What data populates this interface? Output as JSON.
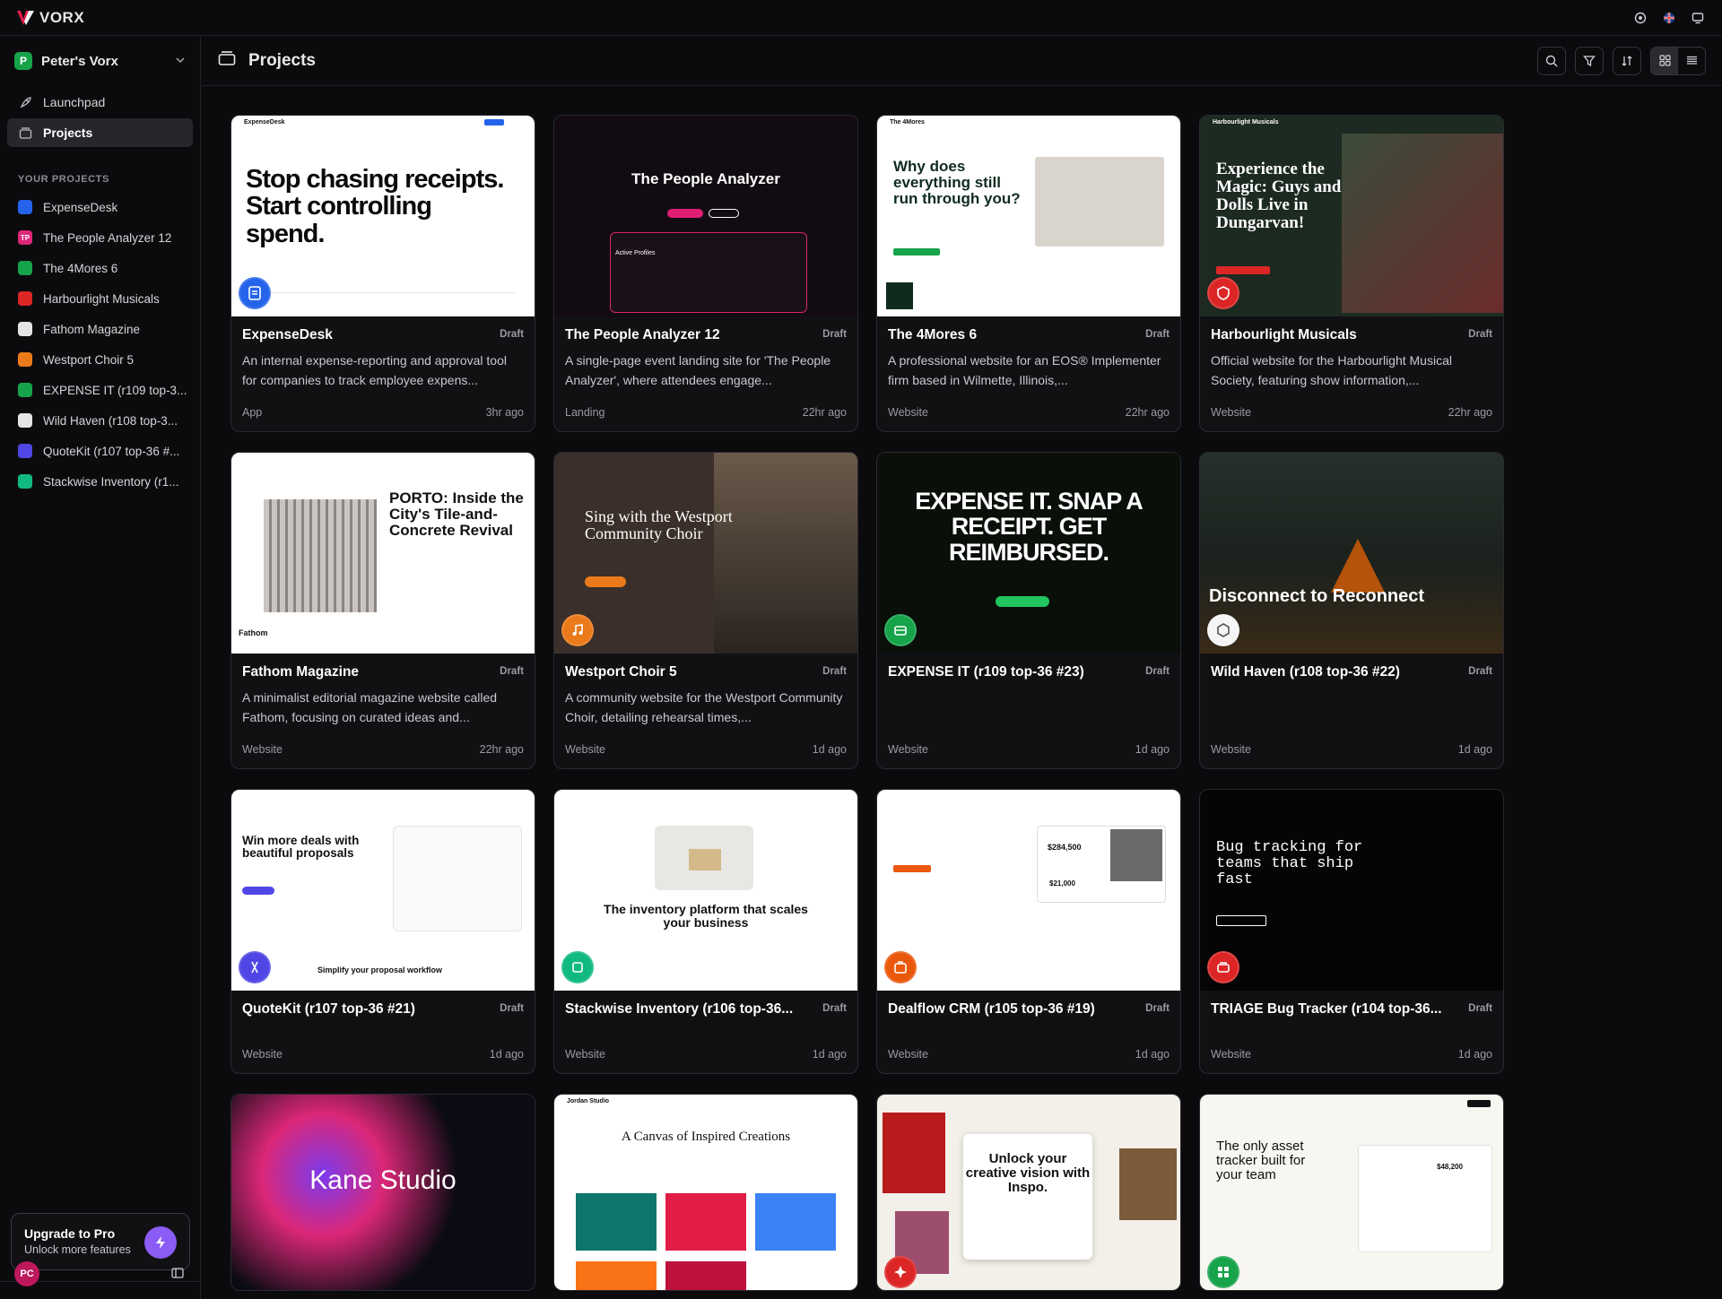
{
  "app": {
    "logo_text": "VORX"
  },
  "sidebar": {
    "workspace": {
      "badge": "P",
      "name": "Peter's Vorx"
    },
    "nav": [
      {
        "label": "Launchpad"
      },
      {
        "label": "Projects"
      }
    ],
    "section_title": "YOUR PROJECTS",
    "projects": [
      {
        "label": "ExpenseDesk",
        "icon": "receipt-icon",
        "color": "#2563eb",
        "glyph": ""
      },
      {
        "label": "The People Analyzer 12",
        "icon": "tp-badge",
        "color": "#db2777",
        "glyph": "TP"
      },
      {
        "label": "The 4Mores 6",
        "icon": "grid-logo-icon",
        "color": "#16a34a",
        "glyph": ""
      },
      {
        "label": "Harbourlight Musicals",
        "icon": "shield-icon",
        "color": "#dc2626",
        "glyph": ""
      },
      {
        "label": "Fathom Magazine",
        "icon": "document-icon",
        "color": "#e5e5e5",
        "glyph": ""
      },
      {
        "label": "Westport Choir 5",
        "icon": "music-icon",
        "color": "#ea7a1a",
        "glyph": ""
      },
      {
        "label": "EXPENSE IT (r109 top-3...",
        "icon": "wallet-icon",
        "color": "#16a34a",
        "glyph": ""
      },
      {
        "label": "Wild Haven (r108 top-3...",
        "icon": "cube-icon",
        "color": "#e5e5e5",
        "glyph": ""
      },
      {
        "label": "QuoteKit (r107 top-36 #...",
        "icon": "quote-icon",
        "color": "#4f46e5",
        "glyph": ""
      },
      {
        "label": "Stackwise Inventory (r1...",
        "icon": "box-icon",
        "color": "#10b981",
        "glyph": ""
      }
    ],
    "upgrade": {
      "title": "Upgrade to Pro",
      "subtitle": "Unlock more features"
    },
    "avatar": "PC"
  },
  "header": {
    "title": "Projects"
  },
  "cards": [
    {
      "name": "ExpenseDesk",
      "status": "Draft",
      "desc": "An internal expense-reporting and approval tool for companies to track employee expens...",
      "type": "App",
      "time": "3hr ago",
      "icon_color": "#2563eb",
      "thumb": {
        "headline": "Stop chasing receipts. Start controlling spend.",
        "brand": "ExpenseDesk"
      }
    },
    {
      "name": "The People Analyzer 12",
      "status": "Draft",
      "desc": "A single-page event landing site for 'The People Analyzer', where attendees engage...",
      "type": "Landing",
      "time": "22hr ago",
      "icon_color": "",
      "thumb": {
        "headline": "The People Analyzer",
        "sub": "Active Profiles"
      }
    },
    {
      "name": "The 4Mores 6",
      "status": "Draft",
      "desc": "A professional website for an EOS® Implementer firm based in Wilmette, Illinois,...",
      "type": "Website",
      "time": "22hr ago",
      "icon_color": "",
      "thumb": {
        "headline": "Why does everything still run through you?",
        "brand": "The 4Mores"
      }
    },
    {
      "name": "Harbourlight Musicals",
      "status": "Draft",
      "desc": "Official website for the Harbourlight Musical Society, featuring show information,...",
      "type": "Website",
      "time": "22hr ago",
      "icon_color": "#dc2626",
      "thumb": {
        "headline": "Experience the Magic: Guys and Dolls Live in Dungarvan!",
        "brand": "Harbourlight Musicals"
      }
    },
    {
      "name": "Fathom Magazine",
      "status": "Draft",
      "desc": "A minimalist editorial magazine website called Fathom, focusing on curated ideas and...",
      "type": "Website",
      "time": "22hr ago",
      "icon_color": "",
      "thumb": {
        "headline": "PORTO: Inside the City's Tile-and-Concrete Revival",
        "brand": "Fathom"
      }
    },
    {
      "name": "Westport Choir 5",
      "status": "Draft",
      "desc": "A community website for the Westport Community Choir, detailing rehearsal times,...",
      "type": "Website",
      "time": "1d ago",
      "icon_color": "#ea7a1a",
      "thumb": {
        "headline": "Sing with the Westport Community Choir"
      }
    },
    {
      "name": "EXPENSE IT (r109 top-36 #23)",
      "status": "Draft",
      "desc": "",
      "type": "Website",
      "time": "1d ago",
      "icon_color": "#16a34a",
      "thumb": {
        "headline": "EXPENSE IT. SNAP A RECEIPT. GET REIMBURSED."
      }
    },
    {
      "name": "Wild Haven (r108 top-36 #22)",
      "status": "Draft",
      "desc": "",
      "type": "Website",
      "time": "1d ago",
      "icon_color": "#f5f5f5",
      "thumb": {
        "headline": "Disconnect to Reconnect"
      }
    },
    {
      "name": "QuoteKit (r107 top-36 #21)",
      "status": "Draft",
      "desc": "",
      "type": "Website",
      "time": "1d ago",
      "icon_color": "#4f46e5",
      "thumb": {
        "headline": "Win more deals with beautiful proposals",
        "sub": "Simplify your proposal workflow"
      }
    },
    {
      "name": "Stackwise Inventory (r106 top-36...",
      "status": "Draft",
      "desc": "",
      "type": "Website",
      "time": "1d ago",
      "icon_color": "#10b981",
      "thumb": {
        "headline": "The inventory platform that scales your business"
      }
    },
    {
      "name": "Dealflow CRM (r105 top-36 #19)",
      "status": "Draft",
      "desc": "",
      "type": "Website",
      "time": "1d ago",
      "icon_color": "#ea580c",
      "thumb": {
        "headline": "$284,500",
        "sub": "$21,000"
      }
    },
    {
      "name": "TRIAGE Bug Tracker (r104 top-36...",
      "status": "Draft",
      "desc": "",
      "type": "Website",
      "time": "1d ago",
      "icon_color": "#dc2626",
      "thumb": {
        "headline": "Bug tracking for teams that ship fast"
      }
    },
    {
      "name": "",
      "status": "",
      "desc": "",
      "type": "",
      "time": "",
      "icon_color": "",
      "thumb": {
        "headline": "Kane Studio"
      }
    },
    {
      "name": "",
      "status": "",
      "desc": "",
      "type": "",
      "time": "",
      "icon_color": "",
      "thumb": {
        "headline": "A Canvas of Inspired Creations",
        "brand": "Jordan Studio"
      }
    },
    {
      "name": "",
      "status": "",
      "desc": "",
      "type": "",
      "time": "",
      "icon_color": "#dc2626",
      "thumb": {
        "headline": "Unlock your creative vision with Inspo."
      }
    },
    {
      "name": "",
      "status": "",
      "desc": "",
      "type": "",
      "time": "",
      "icon_color": "#16a34a",
      "thumb": {
        "headline": "The only asset tracker built for your team",
        "sub": "$48,200"
      }
    }
  ]
}
